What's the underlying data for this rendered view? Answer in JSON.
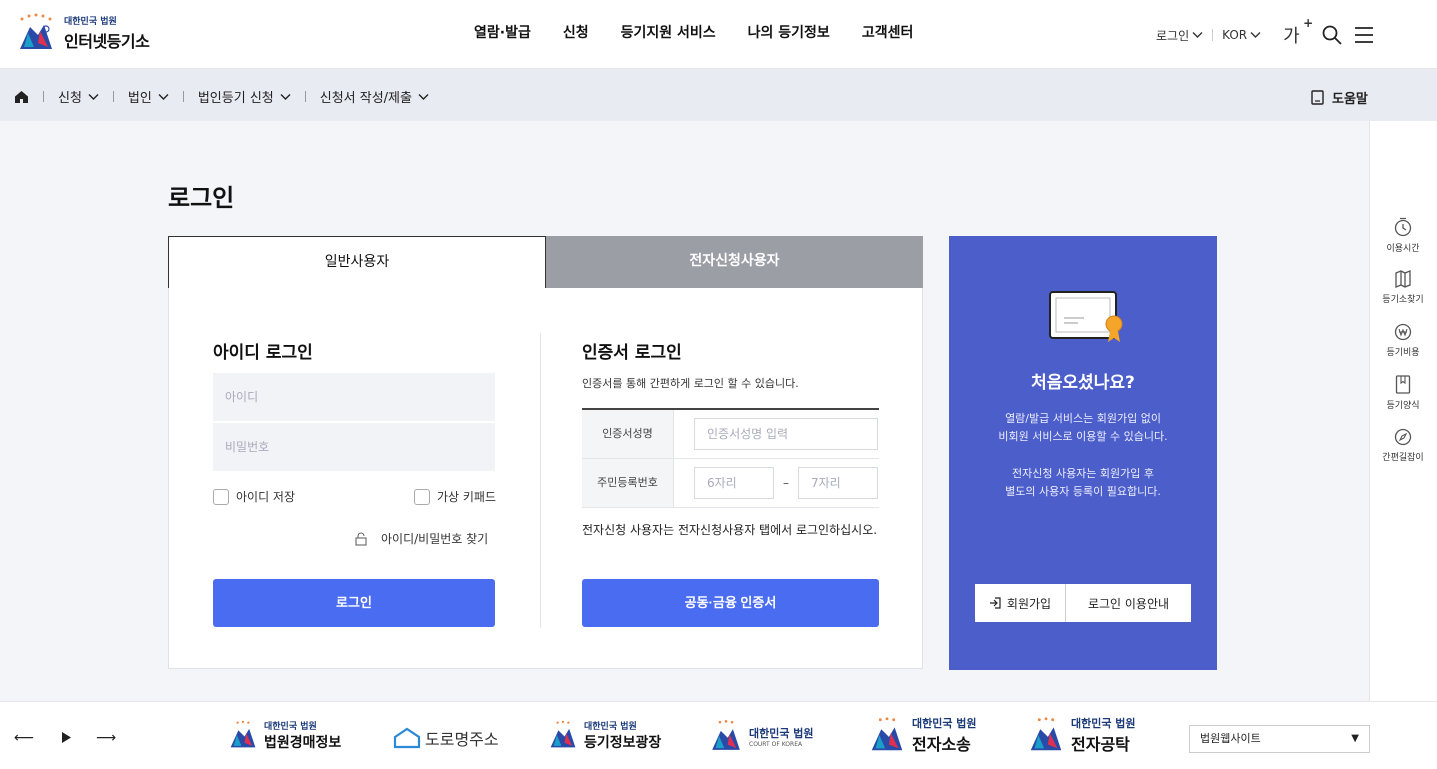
{
  "header": {
    "logo_small": "대한민국 법원",
    "logo_title": "인터넷등기소",
    "menu": [
      "열람·발급",
      "신청",
      "등기지원 서비스",
      "나의 등기정보",
      "고객센터"
    ],
    "login_label": "로그인",
    "lang_label": "KOR",
    "font_size_label": "가",
    "font_size_plus": "+"
  },
  "subnav": {
    "crumbs": [
      "신청",
      "법인",
      "법인등기 신청",
      "신청서 작성/제출"
    ],
    "help_label": "도움말"
  },
  "page_title": "로그인",
  "tabs": {
    "general": "일반사용자",
    "electronic": "전자신청사용자"
  },
  "id_login": {
    "title": "아이디 로그인",
    "id_placeholder": "아이디",
    "pw_placeholder": "비밀번호",
    "save_id": "아이디 저장",
    "virtual_keypad": "가상 키패드",
    "find_link": "아이디/비밀번호 찾기",
    "login_button": "로그인"
  },
  "cert_login": {
    "title": "인증서 로그인",
    "desc": "인증서를 통해 간편하게 로그인 할 수 있습니다.",
    "name_label": "인증서성명",
    "name_placeholder": "인증서성명 입력",
    "rrn_label": "주민등록번호",
    "rrn_front_placeholder": "6자리",
    "rrn_dash": "–",
    "rrn_back_placeholder": "7자리",
    "notice": "전자신청 사용자는 전자신청사용자 탭에서 로그인하십시오.",
    "button": "공동·금융 인증서"
  },
  "join_panel": {
    "question": "처음오셨나요?",
    "desc1_line1": "열람/발급 서비스는 회원가입 없이",
    "desc1_line2": "비회원 서비스로 이용할 수 있습니다.",
    "desc2_line1": "전자신청 사용자는 회원가입 후",
    "desc2_line2": "별도의 사용자 등록이 필요합니다.",
    "join_button": "회원가입",
    "guide_button": "로그인 이용안내"
  },
  "quick_menu": [
    "이용시간",
    "등기소찾기",
    "등기비용",
    "등기양식",
    "간편길잡이"
  ],
  "footer": {
    "prev": "⟵",
    "next": "⟶",
    "banners": [
      {
        "small": "대한민국 법원",
        "large": "법원경매정보"
      },
      {
        "small": "",
        "large": "도로명주소"
      },
      {
        "small": "대한민국 법원",
        "large": "등기정보광장"
      },
      {
        "small": "대한민국 법원",
        "large": "COURT OF KOREA"
      },
      {
        "small": "대한민국 법원",
        "large": "전자소송"
      },
      {
        "small": "대한민국 법원",
        "large": "전자공탁"
      }
    ],
    "site_select": "법원웹사이트"
  },
  "colors": {
    "primary_button": "#4a6cf0",
    "join_panel": "#4b5ec9",
    "inactive_tab": "#9c9ea6"
  }
}
